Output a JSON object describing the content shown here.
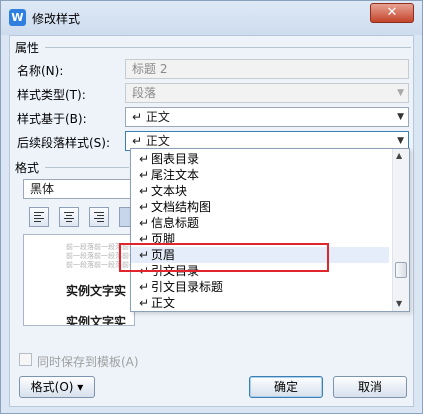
{
  "window": {
    "title": "修改样式",
    "app_icon": "wps-writer-icon"
  },
  "properties": {
    "section_label": "属性",
    "name_label": "名称(N):",
    "name_value": "标题 2",
    "type_label": "样式类型(T):",
    "type_value": "段落",
    "based_on_label": "样式基于(B):",
    "based_on_value": "↵ 正文",
    "next_label": "后续段落样式(S):",
    "next_value": "↵ 正文"
  },
  "format": {
    "section_label": "格式",
    "font_value": "黑体"
  },
  "dropdown": {
    "items": [
      "图表目录",
      "尾注文本",
      "文本块",
      "文档结构图",
      "信息标题",
      "页脚",
      "页眉",
      "引文目录",
      "引文目录标题",
      "正文"
    ],
    "selected": "页眉"
  },
  "preview": {
    "ghost_line": "前一段落前一段落前一",
    "sample_line": "实例文字实",
    "sample_line_2": "实例文字实"
  },
  "footer": {
    "checkbox_label": "同时保存到模板(A)",
    "format_button": "格式(O) ▾",
    "ok_button": "确定",
    "cancel_button": "取消"
  },
  "colors": {
    "highlight": "#e0262c",
    "titlebar": "#dfe9f6",
    "close": "#c4442c"
  }
}
